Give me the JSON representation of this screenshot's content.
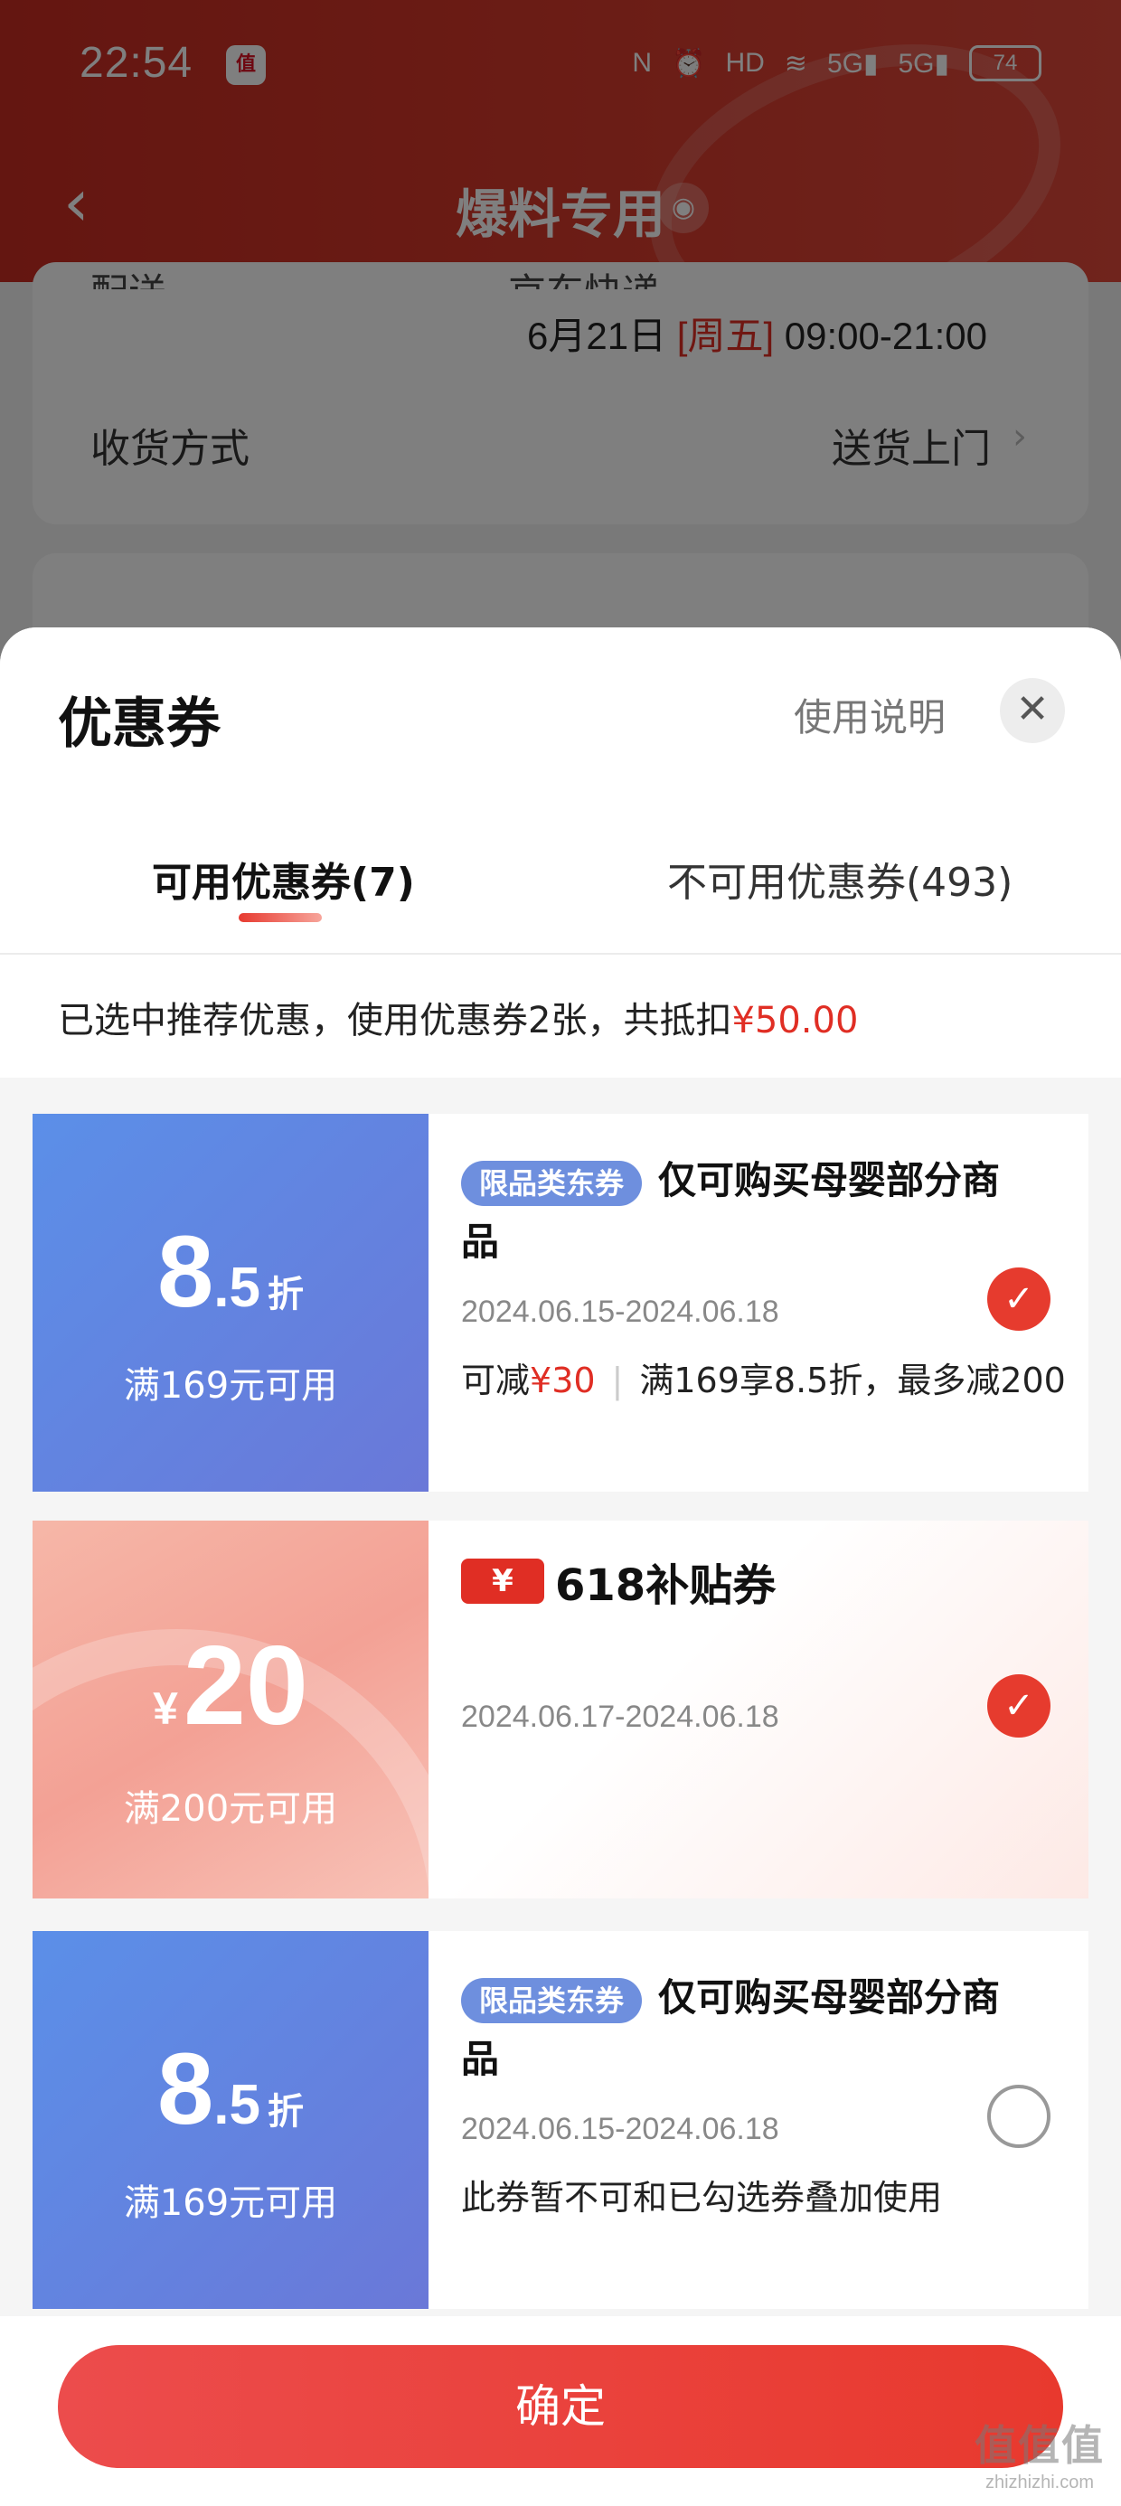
{
  "status_bar": {
    "time": "22:54",
    "app_badge": "值",
    "icons": [
      "nfc-icon",
      "alarm-icon",
      "hd-icon",
      "wifi-icon",
      "signal-5g-icon",
      "signal-5g-icon"
    ],
    "nfc": "N",
    "alarm": "⏰",
    "hd": "HD",
    "wifi": "≋",
    "sig1": "5G▮",
    "sig2": "5G▮",
    "battery": "74"
  },
  "navbar": {
    "back": "‹",
    "title": "爆料专用",
    "location": "◉"
  },
  "background": {
    "delivery_top": "配送　　　　　　　　　京东快递",
    "delivery_date": "6月21日",
    "delivery_weekday": "[周五]",
    "delivery_time": "09:00-21:00",
    "receive_label": "收货方式",
    "receive_value": "送货上门",
    "chevron": "›"
  },
  "sheet": {
    "title": "优惠券",
    "usage_link": "使用说明",
    "close": "✕",
    "tabs": [
      {
        "label": "可用优惠券(7)",
        "active": true
      },
      {
        "label": "不可用优惠券(493)",
        "active": false
      }
    ],
    "summary_prefix": "已选中推荐优惠，使用优惠券2张，共抵扣",
    "summary_amount": "¥50.00"
  },
  "coupons": [
    {
      "discount_big": "8",
      "discount_small": ".5",
      "discount_unit": "折",
      "condition": "满169元可用",
      "tag": "限品类东券",
      "title": "仅可购买母婴部分商品",
      "date": "2024.06.15-2024.06.18",
      "detail_prefix": "可减",
      "detail_amount": "¥30",
      "detail_rest": "满169享8.5折，最多减200...",
      "checked": true
    },
    {
      "amount_symbol": "¥",
      "amount": "20",
      "condition": "满200元可用",
      "brand_yen": "¥",
      "brand_text": "618补贴券",
      "date": "2024.06.17-2024.06.18",
      "checked": true
    },
    {
      "discount_big": "8",
      "discount_small": ".5",
      "discount_unit": "折",
      "condition": "满169元可用",
      "tag": "限品类东券",
      "title": "仅可购买母婴部分商品",
      "date": "2024.06.15-2024.06.18",
      "note": "此券暂不可和已勾选券叠加使用",
      "checked": false
    }
  ],
  "check_mark": "✓",
  "confirm_button": "确定",
  "watermark": {
    "line1": "值值值",
    "line2": "zhizhizhi.com"
  },
  "colors": {
    "brand_red": "#e02e24",
    "coupon_blue": "#5b8fe8",
    "coupon_pink": "#f3a195"
  }
}
